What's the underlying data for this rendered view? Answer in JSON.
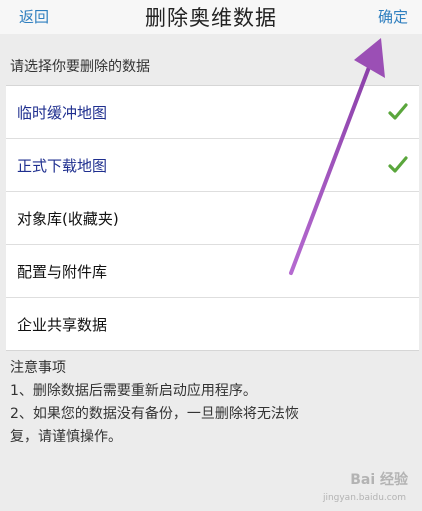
{
  "header": {
    "back_label": "返回",
    "title": "删除奥维数据",
    "confirm_label": "确定"
  },
  "section_label": "请选择你要删除的数据",
  "items": [
    {
      "label": "临时缓冲地图",
      "selected": true
    },
    {
      "label": "正式下载地图",
      "selected": true
    },
    {
      "label": "对象库(收藏夹)",
      "selected": false
    },
    {
      "label": "配置与附件库",
      "selected": false
    },
    {
      "label": "企业共享数据",
      "selected": false
    }
  ],
  "notes": {
    "title": "注意事项",
    "line1": "1、删除数据后需要重新启动应用程序。",
    "line2a": "2、如果您的数据没有备份，一旦删除将无法恢",
    "line2b": "复，请谨慎操作。"
  },
  "watermark": {
    "text": "Bai 经验",
    "sub": "jingyan.baidu.com"
  },
  "colors": {
    "accent": "#2f7fbf",
    "selected_text": "#1f2f8f",
    "check": "#5aa63c",
    "arrow": "#9b4fb5"
  }
}
